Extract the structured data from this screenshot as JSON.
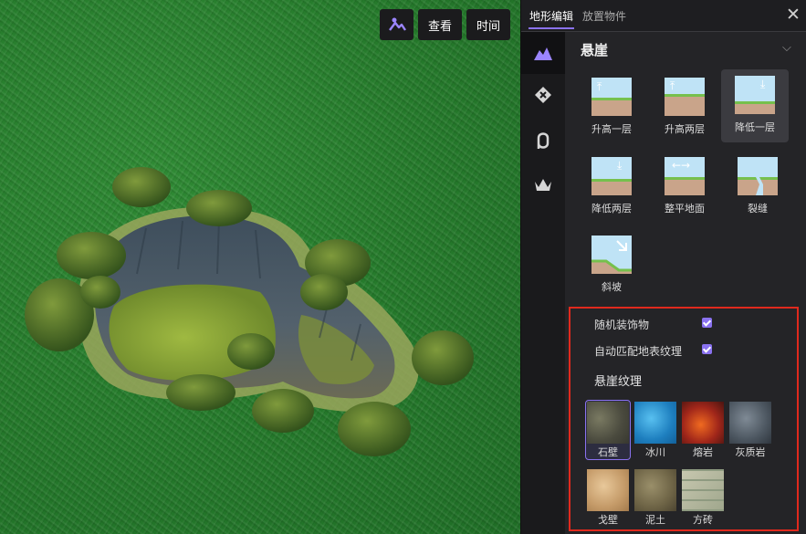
{
  "viewport": {
    "buttons": {
      "terrain_icon": "terrain-edit-icon",
      "view": "查看",
      "time": "时间"
    }
  },
  "panel": {
    "tabs": [
      {
        "label": "地形编辑",
        "active": true
      },
      {
        "label": "放置物件",
        "active": false
      }
    ],
    "close": "✕",
    "rail": [
      {
        "icon": "mountain-icon",
        "active": true
      },
      {
        "icon": "eraser-icon",
        "active": false
      },
      {
        "icon": "path-icon",
        "active": false
      },
      {
        "icon": "crown-plant-icon",
        "active": false
      }
    ],
    "section": {
      "title": "悬崖",
      "tools": [
        {
          "label": "升高一层",
          "icon": "raise-one-icon",
          "selected": false
        },
        {
          "label": "升高两层",
          "icon": "raise-two-icon",
          "selected": false
        },
        {
          "label": "降低一层",
          "icon": "lower-one-icon",
          "selected": true
        },
        {
          "label": "降低两层",
          "icon": "lower-two-icon",
          "selected": false
        },
        {
          "label": "整平地面",
          "icon": "flatten-icon",
          "selected": false
        },
        {
          "label": "裂缝",
          "icon": "crack-icon",
          "selected": false
        },
        {
          "label": "斜坡",
          "icon": "slope-icon",
          "selected": false
        }
      ]
    },
    "options": {
      "random_decor": {
        "label": "随机装饰物",
        "checked": true
      },
      "auto_match": {
        "label": "自动匹配地表纹理",
        "checked": true
      },
      "texture_title": "悬崖纹理",
      "textures": [
        {
          "label": "石壁",
          "selected": true
        },
        {
          "label": "冰川",
          "selected": false
        },
        {
          "label": "熔岩",
          "selected": false
        },
        {
          "label": "灰质岩",
          "selected": false
        },
        {
          "label": "戈壁",
          "selected": false
        },
        {
          "label": "泥土",
          "selected": false
        },
        {
          "label": "方砖",
          "selected": false
        }
      ]
    }
  },
  "colors": {
    "accent": "#8a72f0",
    "highlight_border": "#e0291d",
    "grass": "#2a7d2e",
    "panel_bg": "#242427"
  }
}
